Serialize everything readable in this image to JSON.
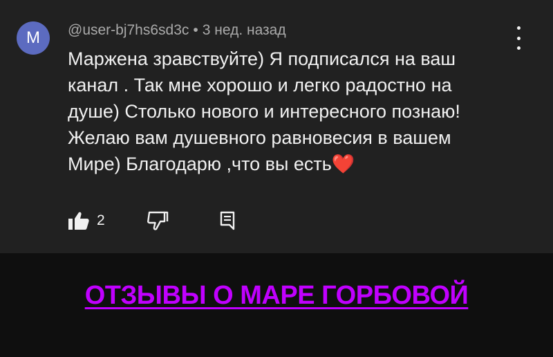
{
  "comment": {
    "avatar_letter": "M",
    "avatar_color": "#5c6bc0",
    "author": "@user-bj7hs6sd3c",
    "separator": "•",
    "time_ago": "3 нед. назад",
    "lines": [
      "Маржена зравствуйте) Я подписался на ваш",
      "канал . Так мне хорошо и легко  радостно на",
      "душе) Столько нового и интересного познаю!",
      "Желаю вам душевного равновесия в вашем",
      "Мире) Благодарю ,что вы есть"
    ],
    "emoji": "❤️",
    "like_count": "2",
    "icons": {
      "menu": "more-vertical-icon",
      "like": "thumbs-up-filled-icon",
      "dislike": "thumbs-down-outline-icon",
      "reply": "reply-comment-icon"
    }
  },
  "banner": {
    "link_text": "ОТЗЫВЫ О МАРЕ ГОРБОВОЙ",
    "link_color": "#c000ff"
  }
}
